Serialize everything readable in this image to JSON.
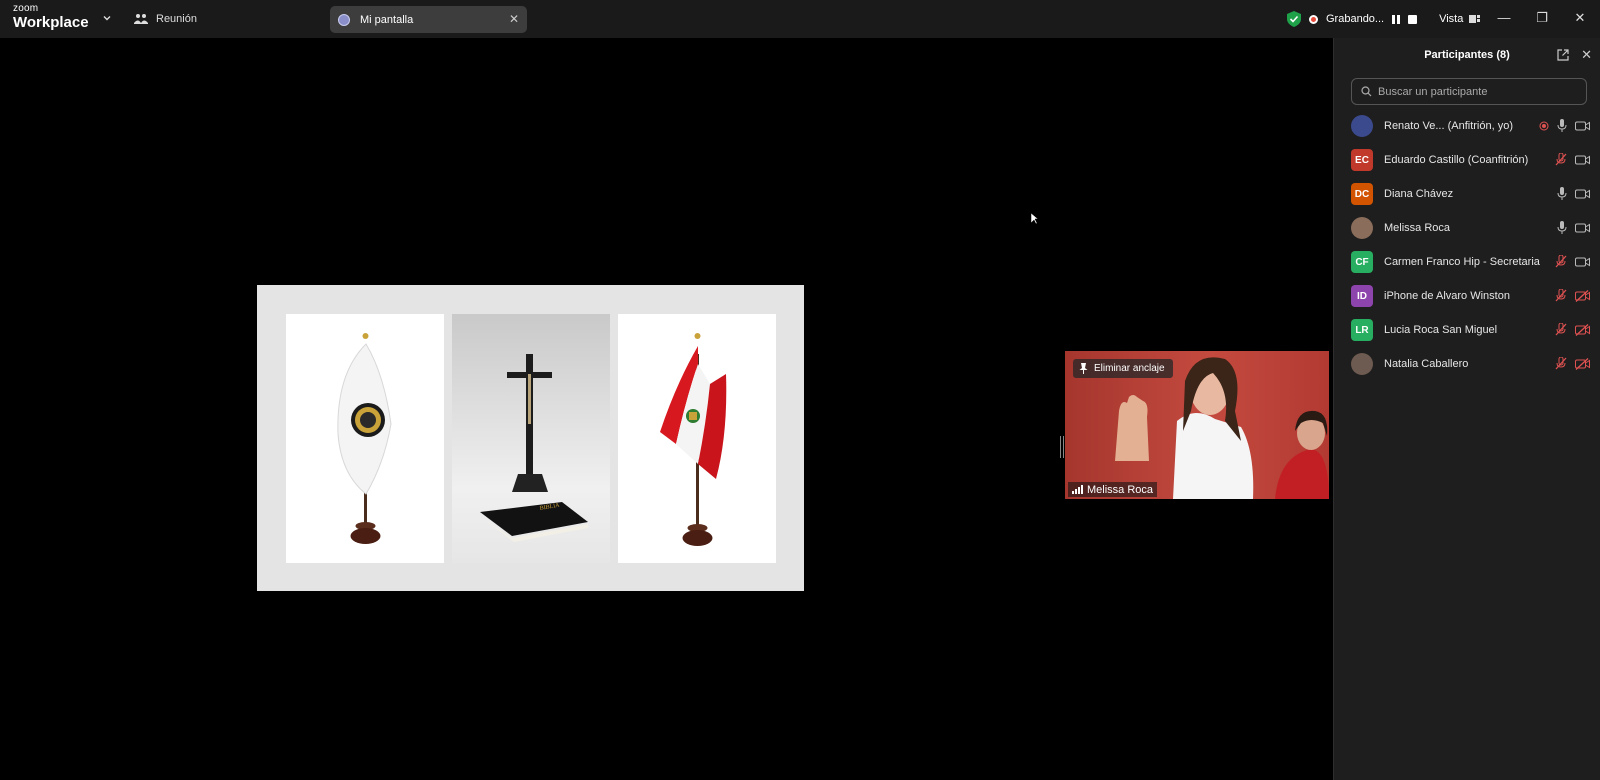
{
  "titlebar": {
    "brand_small": "zoom",
    "brand_large": "Workplace",
    "meeting_tab": "Reunión",
    "screen_tab": "Mi pantalla",
    "recording": "Grabando...",
    "view": "Vista"
  },
  "video": {
    "unpin_label": "Eliminar anclaje",
    "participant_name": "Melissa Roca"
  },
  "participants": {
    "title": "Participantes (8)",
    "search_placeholder": "Buscar un participante",
    "list": [
      {
        "initials": "",
        "name": "Renato Ve... (Anfitrión, yo)",
        "color": "#3b4a8c",
        "mic": "on",
        "cam": "on",
        "host": true
      },
      {
        "initials": "EC",
        "name": "Eduardo Castillo (Coanfitrión)",
        "color": "#c0392b",
        "mic": "muted",
        "cam": "on"
      },
      {
        "initials": "DC",
        "name": "Diana Chávez",
        "color": "#d35400",
        "mic": "on",
        "cam": "on"
      },
      {
        "initials": "",
        "name": "Melissa Roca",
        "color": "#8a6d5a",
        "mic": "on",
        "cam": "on"
      },
      {
        "initials": "CF",
        "name": "Carmen Franco Hip - Secretaria",
        "color": "#27ae60",
        "mic": "muted",
        "cam": "on"
      },
      {
        "initials": "ID",
        "name": "iPhone de Alvaro Winston",
        "color": "#8e44ad",
        "mic": "muted",
        "cam": "off"
      },
      {
        "initials": "LR",
        "name": "Lucia Roca San Miguel",
        "color": "#27ae60",
        "mic": "muted",
        "cam": "off"
      },
      {
        "initials": "",
        "name": "Natalia Caballero",
        "color": "#6d5a50",
        "mic": "muted",
        "cam": "off"
      }
    ]
  },
  "colors": {
    "titlebar_bg": "#1a1a1a",
    "panel_bg": "#1e1e1e",
    "muted_red": "#e05252",
    "secure_green": "#1fa14a"
  }
}
